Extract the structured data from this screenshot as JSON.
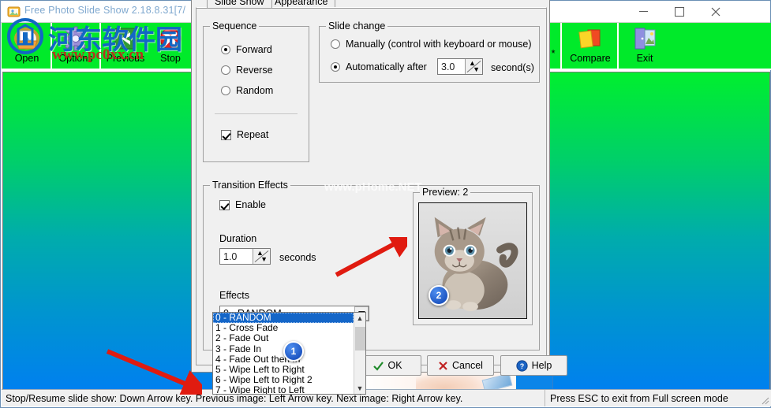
{
  "window": {
    "title": "Free Photo Slide Show 2.18.8.31[7/",
    "icon": "app-photo-icon",
    "minimize_label": "—",
    "maximize_label": "□",
    "close_label": "✕"
  },
  "toolbar": {
    "buttons": [
      {
        "label": "Open",
        "icon": "open-folder-icon"
      },
      {
        "label": "Options",
        "icon": "gear-icon"
      },
      {
        "label": "Previous",
        "icon": "previous-arrow-icon"
      },
      {
        "label": "Stop",
        "icon": "stop-x-icon"
      },
      {
        "label": "Compare",
        "icon": "compare-cards-icon"
      },
      {
        "label": "Exit",
        "icon": "exit-door-icon"
      }
    ],
    "overflow_label": "*",
    "background_color": "#00ea2a"
  },
  "dialog": {
    "tabs": [
      {
        "label": "Slide Show",
        "active": true
      },
      {
        "label": "Appearance",
        "active": false
      }
    ],
    "sequence": {
      "title": "Sequence",
      "options": [
        {
          "label": "Forward",
          "selected": true
        },
        {
          "label": "Reverse",
          "selected": false
        },
        {
          "label": "Random",
          "selected": false
        }
      ],
      "repeat": {
        "label": "Repeat",
        "checked": true
      }
    },
    "slide_change": {
      "title": "Slide change",
      "manual": {
        "label": "Manually (control with keyboard or mouse)",
        "selected": false
      },
      "automatic": {
        "label": "Automatically after",
        "selected": true
      },
      "interval_value": "3.0",
      "interval_unit": "second(s)"
    },
    "transition": {
      "title": "Transition Effects",
      "enable": {
        "label": "Enable",
        "checked": true
      },
      "duration_label": "Duration",
      "duration_value": "1.0",
      "duration_unit": "seconds",
      "effects_label": "Effects",
      "effects_selected": "0 - RANDOM",
      "effects_options": [
        "0 - RANDOM",
        "1 - Cross Fade",
        "2 - Fade Out",
        "3 - Fade In",
        "4 - Fade Out then In",
        "5 - Wipe Left to Right",
        "6 - Wipe Left to Right 2",
        "7 - Wipe Right to Left"
      ]
    },
    "preview": {
      "title": "Preview: 2",
      "image_alt": "kitten-photo"
    },
    "buttons": {
      "ok": "OK",
      "cancel": "Cancel",
      "help": "Help"
    }
  },
  "annotations": {
    "marker_one": "1",
    "marker_two": "2"
  },
  "statusbar": {
    "left": "Stop/Resume slide show: Down Arrow key. Previous image: Left Arrow key. Next image: Right Arrow key.",
    "right": "Press ESC to exit from Full screen mode"
  },
  "watermarks": {
    "chinese": "河东软件园",
    "url": "www.pc0xx.cn",
    "phome": "www.pHome.NET"
  },
  "colors": {
    "toolbar_green": "#00ea2a",
    "gradient_top": "#00ef2e",
    "gradient_bottom": "#0080ef",
    "selection_blue": "#1466c8",
    "marker_blue": "#0b3fb0",
    "arrow_red": "#e01b10"
  }
}
